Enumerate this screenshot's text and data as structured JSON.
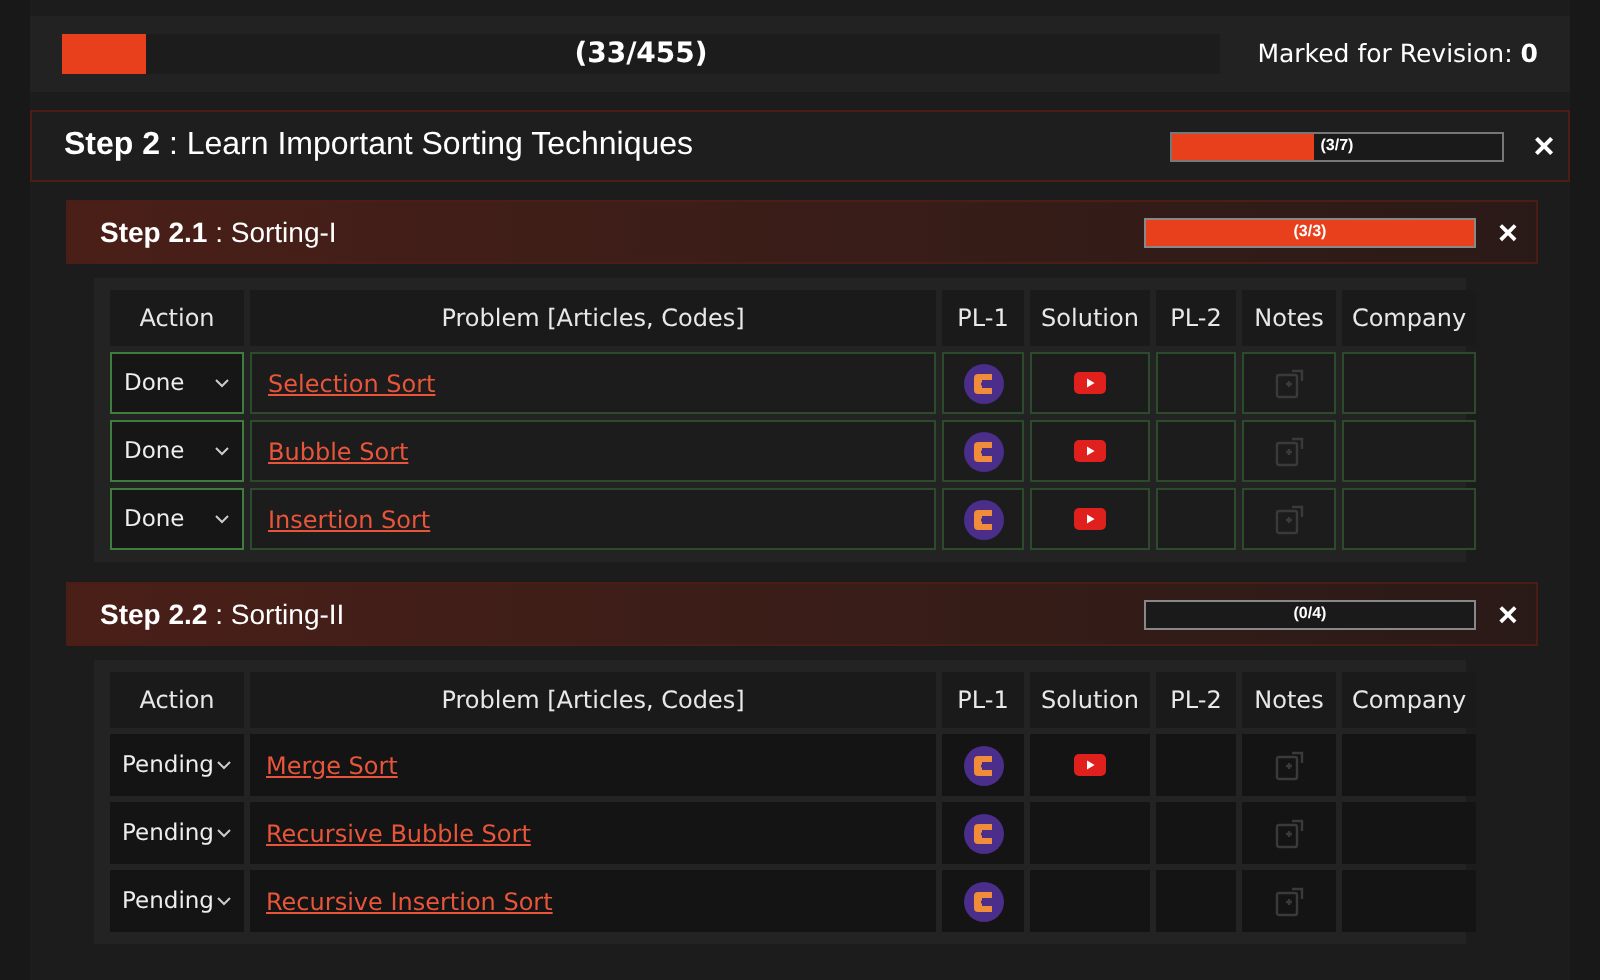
{
  "overall": {
    "level": 0.073,
    "count": "(33/455)",
    "revision_label": "Marked for Revision:",
    "revision_count": "0"
  },
  "step": {
    "number": "Step 2",
    "title": ": Learn Important Sorting Techniques",
    "level": 0.4286,
    "count": "(3/7)",
    "close": "×"
  },
  "substeps": [
    {
      "number": "Step 2.1",
      "title": ": Sorting-I",
      "level": 1,
      "count": "(3/3)",
      "close": "×",
      "columns": [
        "Action",
        "Problem [Articles, Codes]",
        "PL-1",
        "Solution",
        "PL-2",
        "Notes",
        "Company"
      ],
      "rows": [
        {
          "status": "Done",
          "done": true,
          "problem": "Selection Sort",
          "video": true
        },
        {
          "status": "Done",
          "done": true,
          "problem": "Bubble Sort",
          "video": true
        },
        {
          "status": "Done",
          "done": true,
          "problem": "Insertion Sort",
          "video": true
        }
      ]
    },
    {
      "number": "Step 2.2",
      "title": ": Sorting-II",
      "level": 0,
      "count": "(0/4)",
      "close": "×",
      "columns": [
        "Action",
        "Problem [Articles, Codes]",
        "PL-1",
        "Solution",
        "PL-2",
        "Notes",
        "Company"
      ],
      "rows": [
        {
          "status": "Pending",
          "done": false,
          "problem": "Merge Sort",
          "video": true
        },
        {
          "status": "Pending",
          "done": false,
          "problem": "Recursive Bubble Sort",
          "video": false
        },
        {
          "status": "Pending",
          "done": false,
          "problem": "Recursive Insertion Sort",
          "video": false
        }
      ]
    }
  ]
}
